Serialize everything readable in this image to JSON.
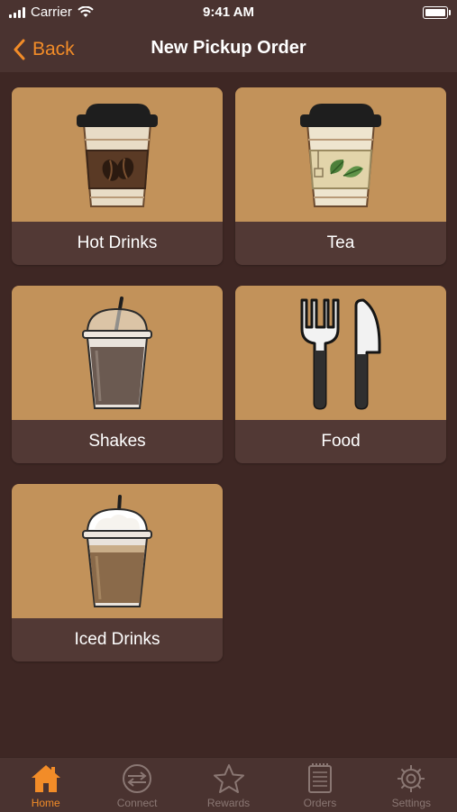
{
  "status_bar": {
    "carrier": "Carrier",
    "time": "9:41 AM"
  },
  "nav": {
    "back_label": "Back",
    "title": "New Pickup Order"
  },
  "categories": [
    {
      "label": "Hot Drinks",
      "icon": "hot-drink-cup-icon"
    },
    {
      "label": "Tea",
      "icon": "tea-cup-icon"
    },
    {
      "label": "Shakes",
      "icon": "shake-cup-icon"
    },
    {
      "label": "Food",
      "icon": "fork-knife-icon"
    },
    {
      "label": "Iced Drinks",
      "icon": "iced-drink-cup-icon"
    }
  ],
  "tab_bar": {
    "active": "Home",
    "items": [
      {
        "label": "Home",
        "icon": "home-icon"
      },
      {
        "label": "Connect",
        "icon": "connect-icon"
      },
      {
        "label": "Rewards",
        "icon": "star-icon"
      },
      {
        "label": "Orders",
        "icon": "orders-icon"
      },
      {
        "label": "Settings",
        "icon": "gear-icon"
      }
    ]
  },
  "colors": {
    "accent": "#f28c28",
    "background": "#3e2724",
    "tile_image": "#c2925a",
    "tile_label": "#523935"
  }
}
